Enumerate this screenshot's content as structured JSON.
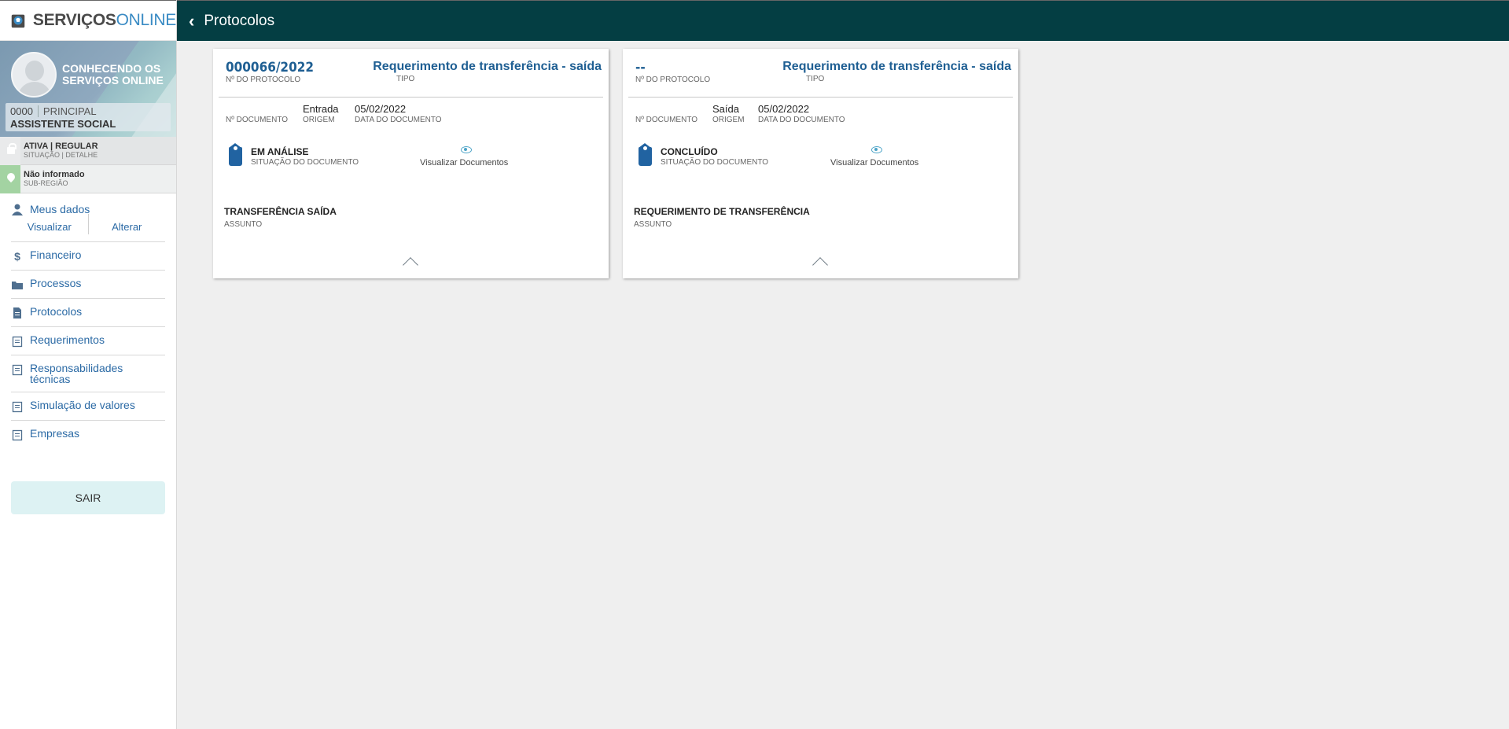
{
  "sidebar": {
    "logo": {
      "part1": "SERVIÇOS",
      "part2": "ONLINE"
    },
    "profile": {
      "name": "CONHECENDO OS SERVIÇOS ONLINE",
      "registration_number": "0000",
      "category": "PRINCIPAL",
      "profession": "ASSISTENTE SOCIAL"
    },
    "status": {
      "value": "ATIVA | REGULAR",
      "label": "SITUAÇÃO | DETALHE"
    },
    "region": {
      "value": "Não informado",
      "label": "SUB-REGIÃO"
    },
    "menu": {
      "my_data": {
        "label": "Meus dados",
        "view": "Visualizar",
        "edit": "Alterar"
      },
      "items": [
        {
          "label": "Financeiro",
          "icon": "dollar-icon"
        },
        {
          "label": "Processos",
          "icon": "folder-icon"
        },
        {
          "label": "Protocolos",
          "icon": "document-icon"
        },
        {
          "label": "Requerimentos",
          "icon": "clipboard-icon"
        },
        {
          "label": "Responsabilidades técnicas",
          "icon": "clipboard-icon"
        },
        {
          "label": "Simulação de valores",
          "icon": "clipboard-icon"
        },
        {
          "label": "Empresas",
          "icon": "clipboard-icon"
        }
      ]
    },
    "logout": "SAIR"
  },
  "header": {
    "title": "Protocolos",
    "back_icon": "chevron-left-icon"
  },
  "labels": {
    "protocol_number": "Nº DO PROTOCOLO",
    "type": "TIPO",
    "document_number": "Nº DOCUMENTO",
    "origin": "ORIGEM",
    "document_date": "DATA DO DOCUMENTO",
    "document_status": "SITUAÇÃO DO DOCUMENTO",
    "view_documents": "Visualizar Documentos",
    "subject": "ASSUNTO"
  },
  "cards": [
    {
      "protocol_number": "000066/2022",
      "type": "Requerimento de transferência - saída",
      "origin": "Entrada",
      "date": "05/02/2022",
      "status": "EM ANÁLISE",
      "subject": "TRANSFERÊNCIA SAÍDA"
    },
    {
      "protocol_number": "--",
      "type": "Requerimento de transferência - saída",
      "origin": "Saída",
      "date": "05/02/2022",
      "status": "CONCLUÍDO",
      "subject": "REQUERIMENTO DE TRANSFERÊNCIA"
    }
  ],
  "colors": {
    "header_bg": "#043e43",
    "link": "#2b6aa5",
    "title_blue": "#1f5f93",
    "tag_blue": "#2163a1",
    "logout_bg": "#ddf2f3"
  }
}
